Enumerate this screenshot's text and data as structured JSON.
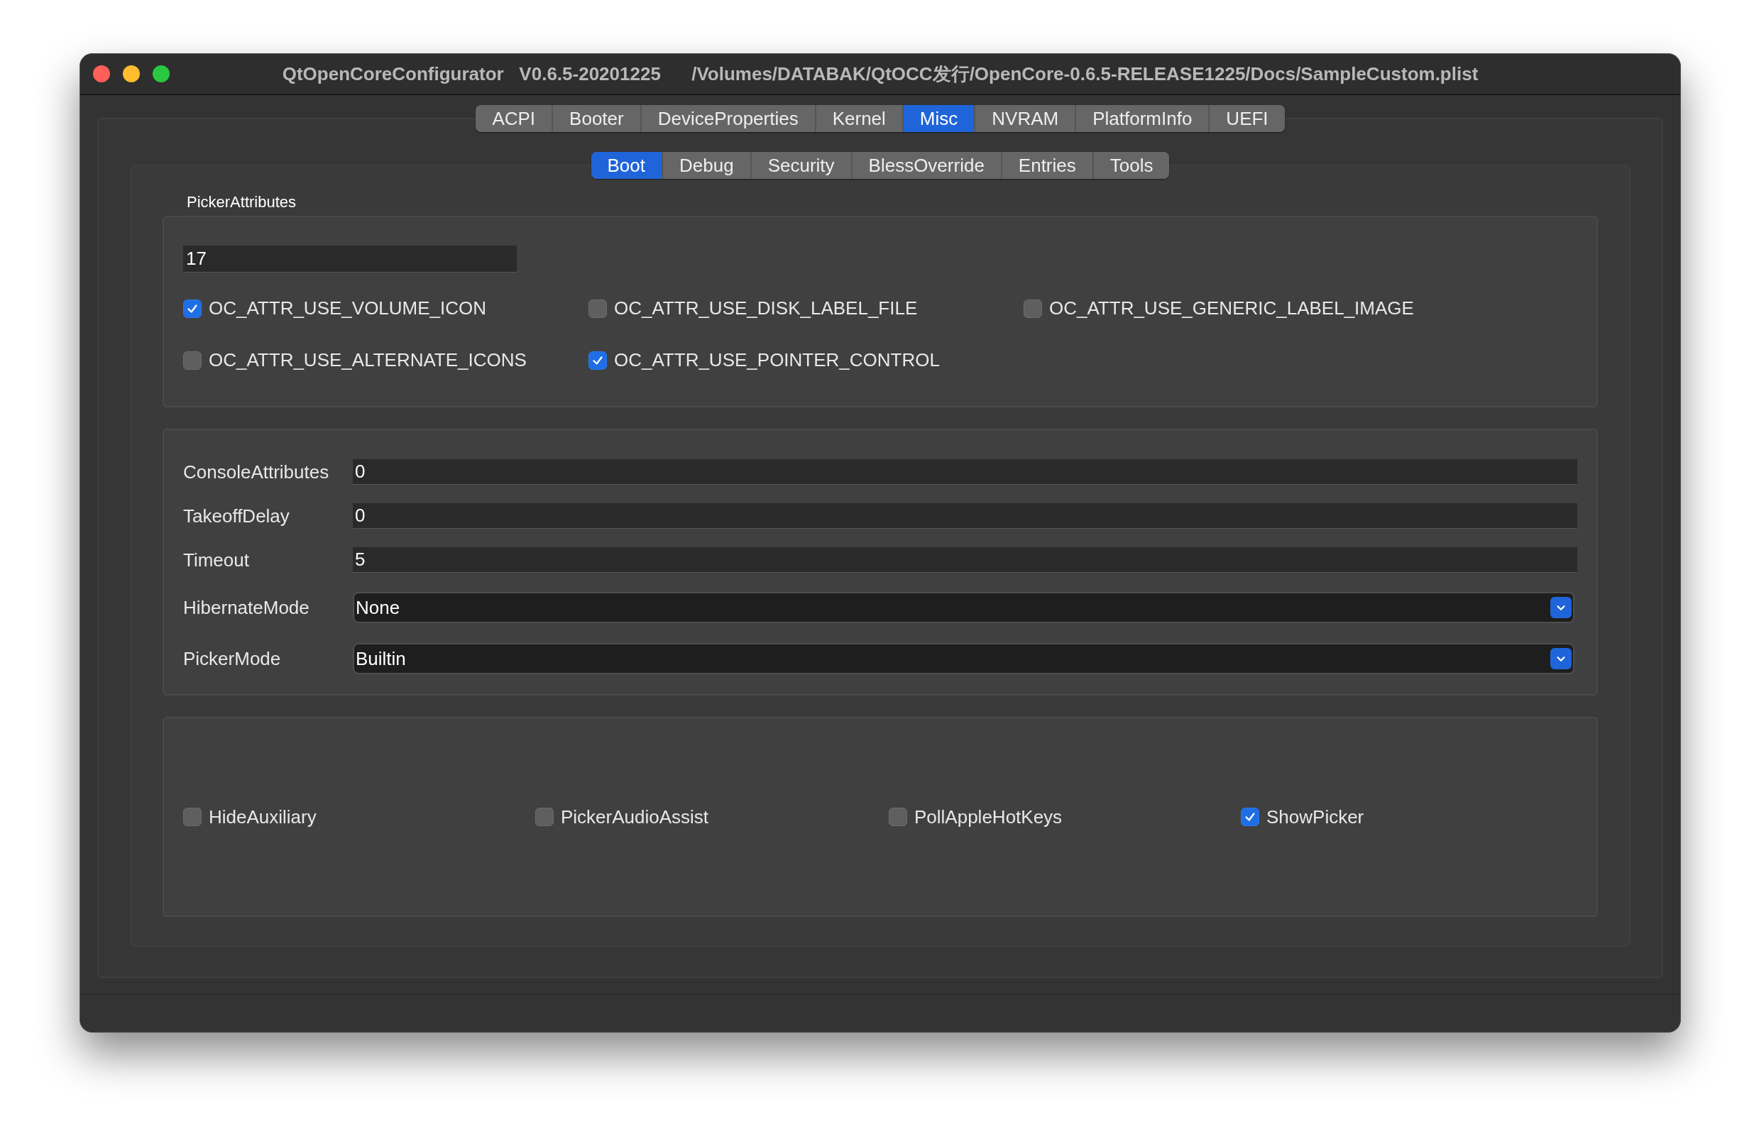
{
  "window": {
    "title": "QtOpenCoreConfigurator   V0.6.5-20201225      /Volumes/DATABAK/QtOCC发行/OpenCore-0.6.5-RELEASE1225/Docs/SampleCustom.plist"
  },
  "tabs": [
    {
      "label": "ACPI",
      "selected": false
    },
    {
      "label": "Booter",
      "selected": false
    },
    {
      "label": "DeviceProperties",
      "selected": false
    },
    {
      "label": "Kernel",
      "selected": false
    },
    {
      "label": "Misc",
      "selected": true
    },
    {
      "label": "NVRAM",
      "selected": false
    },
    {
      "label": "PlatformInfo",
      "selected": false
    },
    {
      "label": "UEFI",
      "selected": false
    }
  ],
  "subtabs": [
    {
      "label": "Boot",
      "selected": true
    },
    {
      "label": "Debug",
      "selected": false
    },
    {
      "label": "Security",
      "selected": false
    },
    {
      "label": "BlessOverride",
      "selected": false
    },
    {
      "label": "Entries",
      "selected": false
    },
    {
      "label": "Tools",
      "selected": false
    }
  ],
  "picker_attributes": {
    "title": "PickerAttributes",
    "value": "17",
    "flags": [
      {
        "label": "OC_ATTR_USE_VOLUME_ICON",
        "checked": true
      },
      {
        "label": "OC_ATTR_USE_DISK_LABEL_FILE",
        "checked": false
      },
      {
        "label": "OC_ATTR_USE_GENERIC_LABEL_IMAGE",
        "checked": false
      },
      {
        "label": "OC_ATTR_USE_ALTERNATE_ICONS",
        "checked": false
      },
      {
        "label": "OC_ATTR_USE_POINTER_CONTROL",
        "checked": true
      }
    ]
  },
  "settings": [
    {
      "label": "ConsoleAttributes",
      "value": "0",
      "kind": "text"
    },
    {
      "label": "TakeoffDelay",
      "value": "0",
      "kind": "text"
    },
    {
      "label": "Timeout",
      "value": "5",
      "kind": "text"
    },
    {
      "label": "HibernateMode",
      "value": "None",
      "kind": "dropdown"
    },
    {
      "label": "PickerMode",
      "value": "Builtin",
      "kind": "dropdown"
    }
  ],
  "options": [
    {
      "label": "HideAuxiliary",
      "checked": false
    },
    {
      "label": "PickerAudioAssist",
      "checked": false
    },
    {
      "label": "PollAppleHotKeys",
      "checked": false
    },
    {
      "label": "ShowPicker",
      "checked": true
    }
  ]
}
